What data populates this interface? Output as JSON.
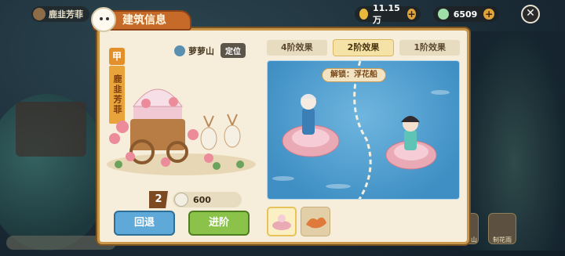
{
  "player": {
    "name": "鹿韭芳菲"
  },
  "resources": [
    {
      "name": "gold-coin-icon",
      "value": "11.15万",
      "color": "#e8b93a"
    },
    {
      "name": "jade-coin-icon",
      "value": "6509",
      "color": "#9fe0a8"
    }
  ],
  "panel": {
    "title": "建筑信息",
    "rank": "甲",
    "building_name": "鹿韭芳菲",
    "location": {
      "name": "萝萝山",
      "locate_label": "定位"
    },
    "level": "2",
    "cost_value": "600",
    "back_label": "回退",
    "advance_label": "进阶"
  },
  "effects": {
    "tabs": [
      {
        "label": "4阶效果",
        "active": false
      },
      {
        "label": "2阶效果",
        "active": true
      },
      {
        "label": "1阶效果",
        "active": false
      }
    ],
    "unlock_text": "解锁：浮花船"
  },
  "side_menu": [
    {
      "label": "花神游山"
    },
    {
      "label": "制花雨"
    }
  ]
}
